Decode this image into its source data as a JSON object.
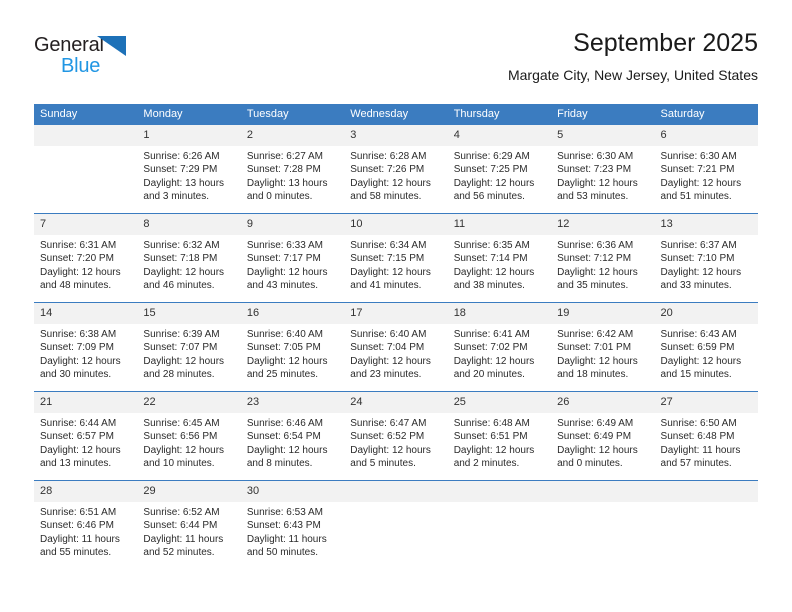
{
  "brand": {
    "name_part1": "General",
    "name_part2": "Blue",
    "triangle_icon": "triangle-icon",
    "accent_blue": "#1d71b8",
    "light_blue": "#2196e3"
  },
  "header": {
    "title": "September 2025",
    "subtitle": "Margate City, New Jersey, United States"
  },
  "calendar": {
    "header_bg": "#3b7cc0",
    "daynum_bg": "#f2f2f2",
    "weekday_headers": [
      "Sunday",
      "Monday",
      "Tuesday",
      "Wednesday",
      "Thursday",
      "Friday",
      "Saturday"
    ],
    "weeks": [
      [
        {
          "day": "",
          "blank": true,
          "sunrise": "",
          "sunset": "",
          "daylight_line1": "",
          "daylight_line2": ""
        },
        {
          "day": "1",
          "sunrise": "Sunrise: 6:26 AM",
          "sunset": "Sunset: 7:29 PM",
          "daylight_line1": "Daylight: 13 hours",
          "daylight_line2": "and 3 minutes."
        },
        {
          "day": "2",
          "sunrise": "Sunrise: 6:27 AM",
          "sunset": "Sunset: 7:28 PM",
          "daylight_line1": "Daylight: 13 hours",
          "daylight_line2": "and 0 minutes."
        },
        {
          "day": "3",
          "sunrise": "Sunrise: 6:28 AM",
          "sunset": "Sunset: 7:26 PM",
          "daylight_line1": "Daylight: 12 hours",
          "daylight_line2": "and 58 minutes."
        },
        {
          "day": "4",
          "sunrise": "Sunrise: 6:29 AM",
          "sunset": "Sunset: 7:25 PM",
          "daylight_line1": "Daylight: 12 hours",
          "daylight_line2": "and 56 minutes."
        },
        {
          "day": "5",
          "sunrise": "Sunrise: 6:30 AM",
          "sunset": "Sunset: 7:23 PM",
          "daylight_line1": "Daylight: 12 hours",
          "daylight_line2": "and 53 minutes."
        },
        {
          "day": "6",
          "sunrise": "Sunrise: 6:30 AM",
          "sunset": "Sunset: 7:21 PM",
          "daylight_line1": "Daylight: 12 hours",
          "daylight_line2": "and 51 minutes."
        }
      ],
      [
        {
          "day": "7",
          "sunrise": "Sunrise: 6:31 AM",
          "sunset": "Sunset: 7:20 PM",
          "daylight_line1": "Daylight: 12 hours",
          "daylight_line2": "and 48 minutes."
        },
        {
          "day": "8",
          "sunrise": "Sunrise: 6:32 AM",
          "sunset": "Sunset: 7:18 PM",
          "daylight_line1": "Daylight: 12 hours",
          "daylight_line2": "and 46 minutes."
        },
        {
          "day": "9",
          "sunrise": "Sunrise: 6:33 AM",
          "sunset": "Sunset: 7:17 PM",
          "daylight_line1": "Daylight: 12 hours",
          "daylight_line2": "and 43 minutes."
        },
        {
          "day": "10",
          "sunrise": "Sunrise: 6:34 AM",
          "sunset": "Sunset: 7:15 PM",
          "daylight_line1": "Daylight: 12 hours",
          "daylight_line2": "and 41 minutes."
        },
        {
          "day": "11",
          "sunrise": "Sunrise: 6:35 AM",
          "sunset": "Sunset: 7:14 PM",
          "daylight_line1": "Daylight: 12 hours",
          "daylight_line2": "and 38 minutes."
        },
        {
          "day": "12",
          "sunrise": "Sunrise: 6:36 AM",
          "sunset": "Sunset: 7:12 PM",
          "daylight_line1": "Daylight: 12 hours",
          "daylight_line2": "and 35 minutes."
        },
        {
          "day": "13",
          "sunrise": "Sunrise: 6:37 AM",
          "sunset": "Sunset: 7:10 PM",
          "daylight_line1": "Daylight: 12 hours",
          "daylight_line2": "and 33 minutes."
        }
      ],
      [
        {
          "day": "14",
          "sunrise": "Sunrise: 6:38 AM",
          "sunset": "Sunset: 7:09 PM",
          "daylight_line1": "Daylight: 12 hours",
          "daylight_line2": "and 30 minutes."
        },
        {
          "day": "15",
          "sunrise": "Sunrise: 6:39 AM",
          "sunset": "Sunset: 7:07 PM",
          "daylight_line1": "Daylight: 12 hours",
          "daylight_line2": "and 28 minutes."
        },
        {
          "day": "16",
          "sunrise": "Sunrise: 6:40 AM",
          "sunset": "Sunset: 7:05 PM",
          "daylight_line1": "Daylight: 12 hours",
          "daylight_line2": "and 25 minutes."
        },
        {
          "day": "17",
          "sunrise": "Sunrise: 6:40 AM",
          "sunset": "Sunset: 7:04 PM",
          "daylight_line1": "Daylight: 12 hours",
          "daylight_line2": "and 23 minutes."
        },
        {
          "day": "18",
          "sunrise": "Sunrise: 6:41 AM",
          "sunset": "Sunset: 7:02 PM",
          "daylight_line1": "Daylight: 12 hours",
          "daylight_line2": "and 20 minutes."
        },
        {
          "day": "19",
          "sunrise": "Sunrise: 6:42 AM",
          "sunset": "Sunset: 7:01 PM",
          "daylight_line1": "Daylight: 12 hours",
          "daylight_line2": "and 18 minutes."
        },
        {
          "day": "20",
          "sunrise": "Sunrise: 6:43 AM",
          "sunset": "Sunset: 6:59 PM",
          "daylight_line1": "Daylight: 12 hours",
          "daylight_line2": "and 15 minutes."
        }
      ],
      [
        {
          "day": "21",
          "sunrise": "Sunrise: 6:44 AM",
          "sunset": "Sunset: 6:57 PM",
          "daylight_line1": "Daylight: 12 hours",
          "daylight_line2": "and 13 minutes."
        },
        {
          "day": "22",
          "sunrise": "Sunrise: 6:45 AM",
          "sunset": "Sunset: 6:56 PM",
          "daylight_line1": "Daylight: 12 hours",
          "daylight_line2": "and 10 minutes."
        },
        {
          "day": "23",
          "sunrise": "Sunrise: 6:46 AM",
          "sunset": "Sunset: 6:54 PM",
          "daylight_line1": "Daylight: 12 hours",
          "daylight_line2": "and 8 minutes."
        },
        {
          "day": "24",
          "sunrise": "Sunrise: 6:47 AM",
          "sunset": "Sunset: 6:52 PM",
          "daylight_line1": "Daylight: 12 hours",
          "daylight_line2": "and 5 minutes."
        },
        {
          "day": "25",
          "sunrise": "Sunrise: 6:48 AM",
          "sunset": "Sunset: 6:51 PM",
          "daylight_line1": "Daylight: 12 hours",
          "daylight_line2": "and 2 minutes."
        },
        {
          "day": "26",
          "sunrise": "Sunrise: 6:49 AM",
          "sunset": "Sunset: 6:49 PM",
          "daylight_line1": "Daylight: 12 hours",
          "daylight_line2": "and 0 minutes."
        },
        {
          "day": "27",
          "sunrise": "Sunrise: 6:50 AM",
          "sunset": "Sunset: 6:48 PM",
          "daylight_line1": "Daylight: 11 hours",
          "daylight_line2": "and 57 minutes."
        }
      ],
      [
        {
          "day": "28",
          "sunrise": "Sunrise: 6:51 AM",
          "sunset": "Sunset: 6:46 PM",
          "daylight_line1": "Daylight: 11 hours",
          "daylight_line2": "and 55 minutes."
        },
        {
          "day": "29",
          "sunrise": "Sunrise: 6:52 AM",
          "sunset": "Sunset: 6:44 PM",
          "daylight_line1": "Daylight: 11 hours",
          "daylight_line2": "and 52 minutes."
        },
        {
          "day": "30",
          "sunrise": "Sunrise: 6:53 AM",
          "sunset": "Sunset: 6:43 PM",
          "daylight_line1": "Daylight: 11 hours",
          "daylight_line2": "and 50 minutes."
        },
        {
          "day": "",
          "blank": true,
          "sunrise": "",
          "sunset": "",
          "daylight_line1": "",
          "daylight_line2": ""
        },
        {
          "day": "",
          "blank": true,
          "sunrise": "",
          "sunset": "",
          "daylight_line1": "",
          "daylight_line2": ""
        },
        {
          "day": "",
          "blank": true,
          "sunrise": "",
          "sunset": "",
          "daylight_line1": "",
          "daylight_line2": ""
        },
        {
          "day": "",
          "blank": true,
          "sunrise": "",
          "sunset": "",
          "daylight_line1": "",
          "daylight_line2": ""
        }
      ]
    ]
  }
}
